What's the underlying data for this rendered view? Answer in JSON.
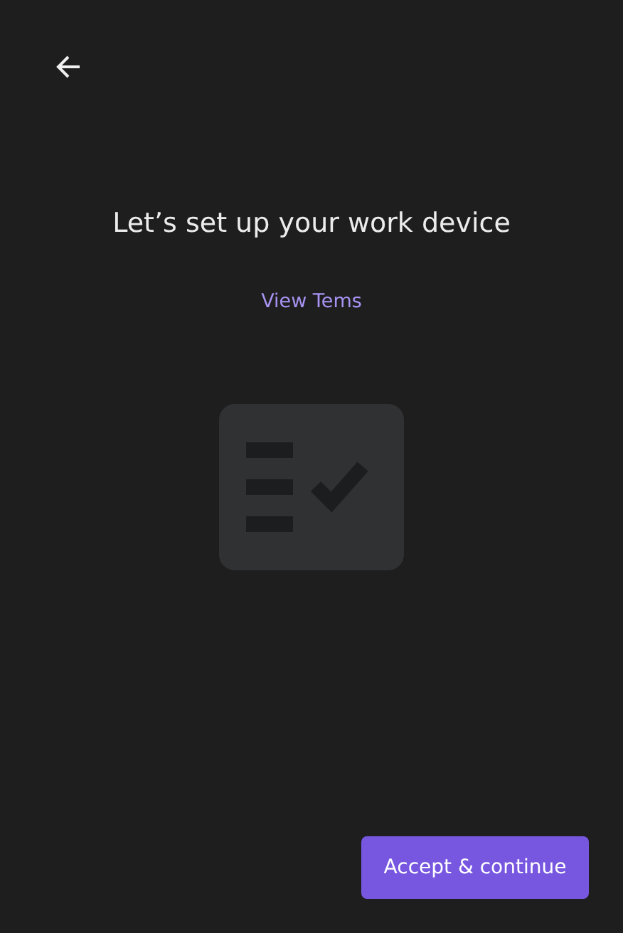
{
  "title": "Let’s set up your work device",
  "terms_link": "View Tems",
  "primary_button": "Accept & continue"
}
